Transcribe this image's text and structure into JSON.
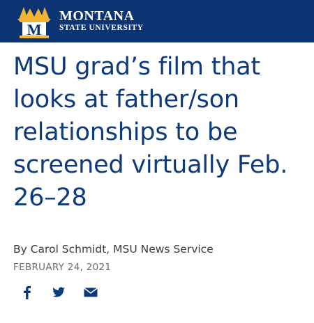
{
  "header": {
    "logo_line1": "MONTANA",
    "logo_line2": "STATE UNIVERSITY",
    "logo_letter": "M",
    "bg_color": "#0d3472",
    "accent_color": "#f2b533"
  },
  "article": {
    "title": "MSU grad’s film that looks at father/son relationships to be screened virtually Feb. 26–28",
    "byline": "By Carol Schmidt, MSU News Service",
    "date": "FEBRUARY 24, 2021"
  },
  "share": {
    "icons": [
      "facebook-icon",
      "twitter-icon",
      "email-icon"
    ],
    "icon_color": "#0d3a7a"
  }
}
